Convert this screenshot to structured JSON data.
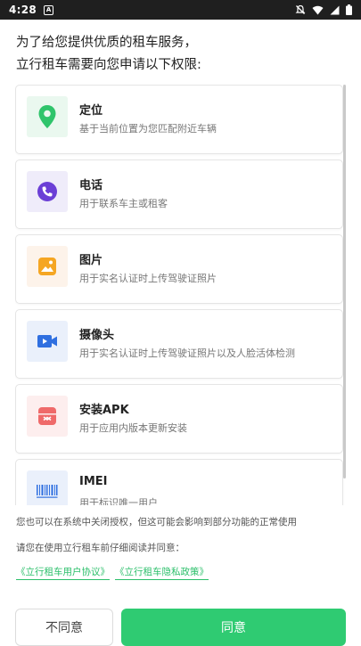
{
  "status_bar": {
    "time": "4:28"
  },
  "intro": {
    "line1": "为了给您提供优质的租车服务，",
    "line2": "立行租车需要向您申请以下权限:"
  },
  "permissions": [
    {
      "title": "定位",
      "desc": "基于当前位置为您匹配附近车辆",
      "icon": "location-icon",
      "bg": "#eaf8ef",
      "color": "#2fc46b"
    },
    {
      "title": "电话",
      "desc": "用于联系车主或租客",
      "icon": "phone-icon",
      "bg": "#efecfa",
      "color": "#6b3fd6"
    },
    {
      "title": "图片",
      "desc": "用于实名认证时上传驾驶证照片",
      "icon": "image-icon",
      "bg": "#fdf3ea",
      "color": "#f5a623"
    },
    {
      "title": "摄像头",
      "desc": "用于实名认证时上传驾驶证照片以及人脸活体检测",
      "icon": "camera-icon",
      "bg": "#eaf0fb",
      "color": "#2f6fe0"
    },
    {
      "title": "安装APK",
      "desc": "用于应用内版本更新安装",
      "icon": "apk-icon",
      "bg": "#fdeeee",
      "color": "#ef6a6a"
    },
    {
      "title": "IMEI",
      "desc": "用于标识唯一用户",
      "icon": "barcode-icon",
      "bg": "#eaf0fb",
      "color": "#2f6fe0"
    }
  ],
  "footer": {
    "note1": "您也可以在系统中关闭授权，但这可能会影响到部分功能的正常使用",
    "note2": "请您在使用立行租车前仔细阅读并同意：",
    "link_agreement": "《立行租车用户协议》",
    "link_privacy": "《立行租车隐私政策》",
    "disagree": "不同意",
    "agree": "同意"
  }
}
